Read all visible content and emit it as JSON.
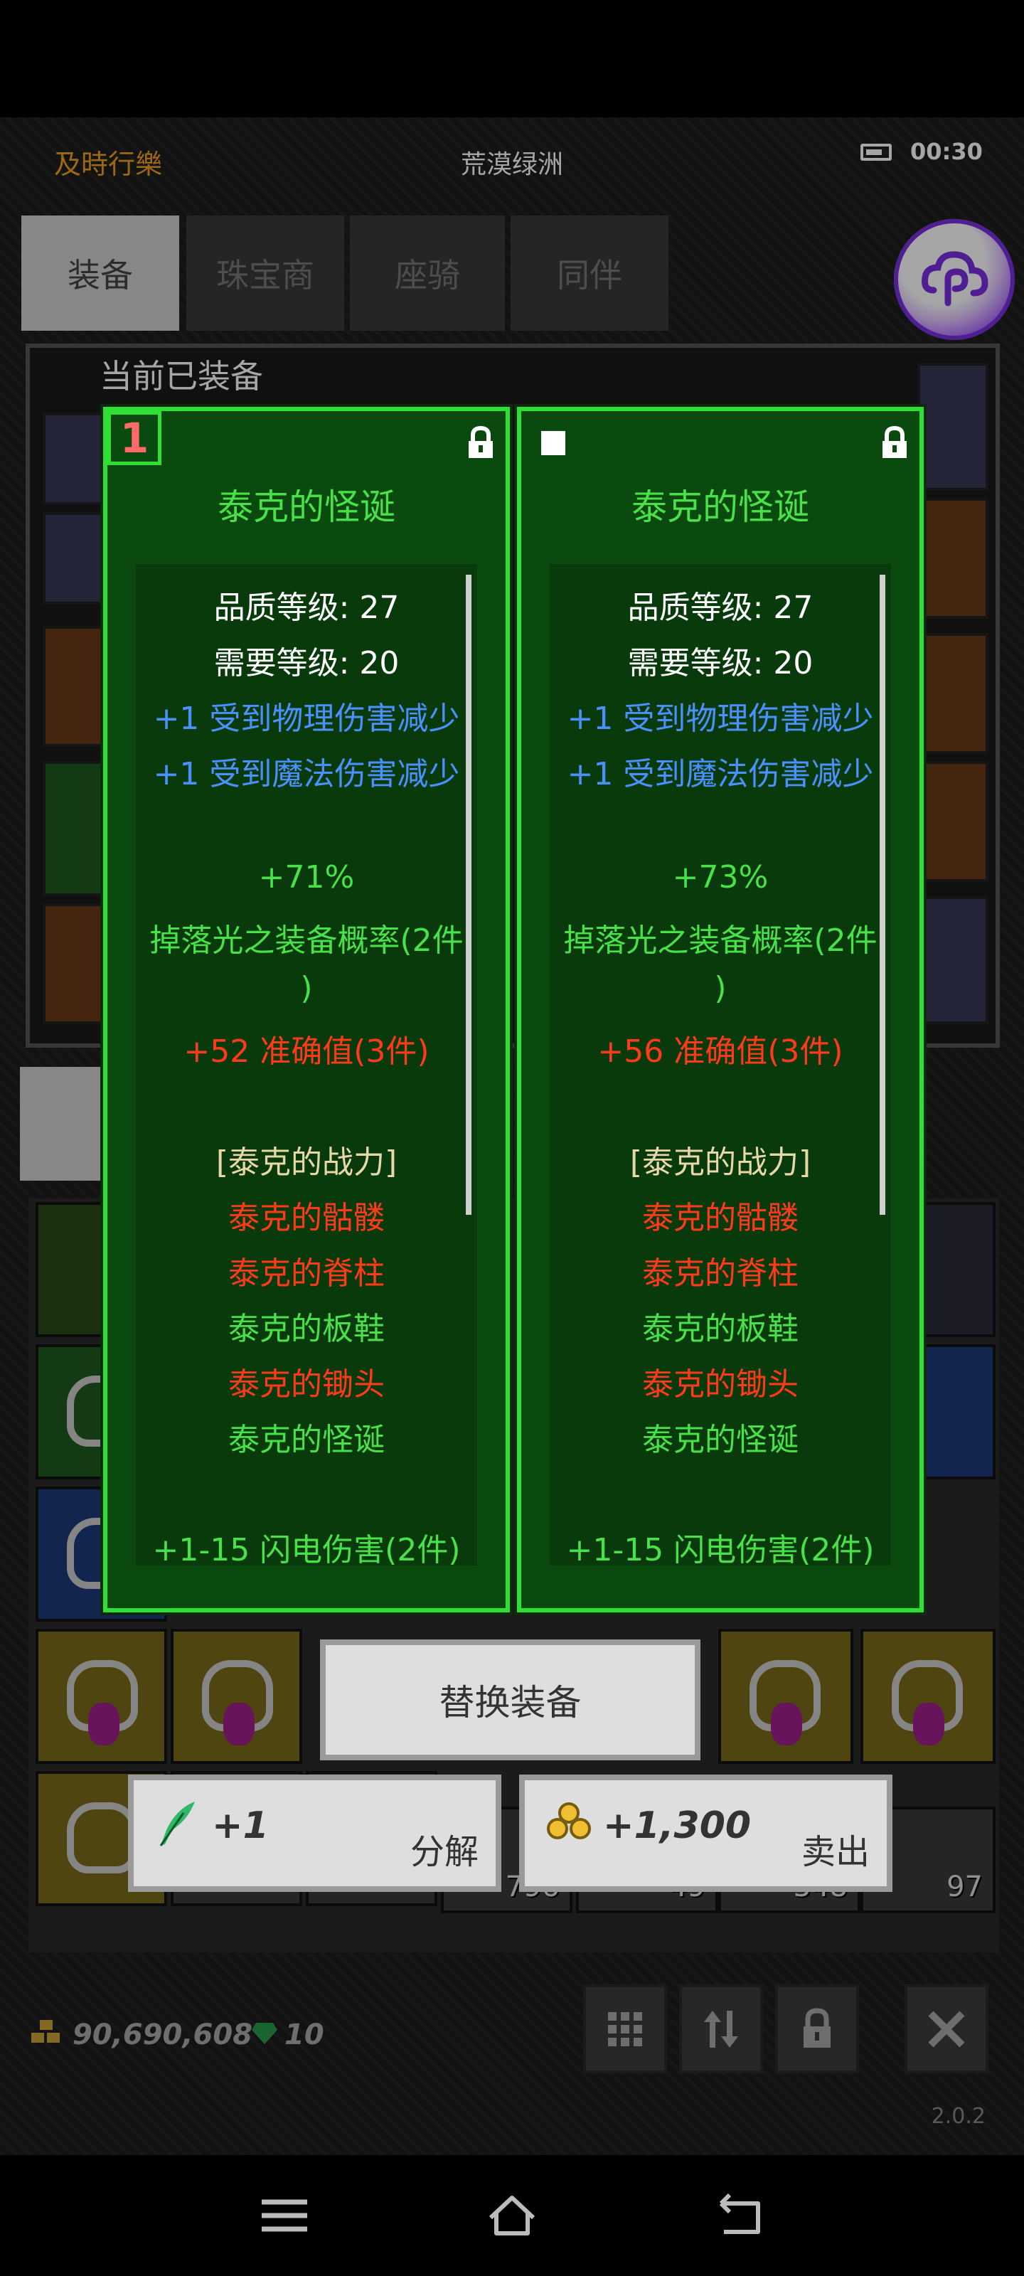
{
  "status_bar": {
    "app_name": "及時行樂",
    "location": "荒漠绿洲",
    "time": "00:30"
  },
  "top_tabs": [
    "装备",
    "珠宝商",
    "座骑",
    "同伴"
  ],
  "equipped_panel": {
    "title": "当前已装备"
  },
  "cards": [
    {
      "badge": "1",
      "name": "泰克的怪诞",
      "quality_level": "品质等级: 27",
      "required_level": "需要等级: 20",
      "mods": [
        "+1 受到物理伤害减少",
        "+1 受到魔法伤害减少"
      ],
      "bonus_pct": "+71%",
      "bonus_desc_1": "掉落光之装备概率(2件",
      "bonus_desc_2": ")",
      "accuracy": "+52 准确值(3件)",
      "set_name": "[泰克的战力]",
      "set_items": [
        "泰克的骷髅",
        "泰克的脊柱",
        "泰克的板鞋",
        "泰克的锄头",
        "泰克的怪诞"
      ],
      "lightning": "+1-15 闪电伤害(2件)"
    },
    {
      "badge": "",
      "name": "泰克的怪诞",
      "quality_level": "品质等级: 27",
      "required_level": "需要等级: 20",
      "mods": [
        "+1 受到物理伤害减少",
        "+1 受到魔法伤害减少"
      ],
      "bonus_pct": "+73%",
      "bonus_desc_1": "掉落光之装备概率(2件",
      "bonus_desc_2": ")",
      "accuracy": "+56 准确值(3件)",
      "set_name": "[泰克的战力]",
      "set_items": [
        "泰克的骷髅",
        "泰克的脊柱",
        "泰克的板鞋",
        "泰克的锄头",
        "泰克的怪诞"
      ],
      "lightning": "+1-15 闪电伤害(2件)"
    }
  ],
  "set_item_colors": [
    "#ff3a1a",
    "#ff3a1a",
    "#49e04a",
    "#ff3a1a",
    "#49e04a"
  ],
  "actions": {
    "replace": "替换装备",
    "dismantle_amount": "+1",
    "dismantle_label": "分解",
    "sell_amount": "+1,300",
    "sell_label": "卖出"
  },
  "inventory_counts": [
    "796",
    "49",
    "548",
    "97"
  ],
  "resources": {
    "gold": "90,690,608",
    "gems": "10"
  },
  "version": "2.0.2",
  "icons": [
    "battery-icon",
    "assistant-icon",
    "lock-icon",
    "feather-icon",
    "gold-coins-icon",
    "emerald-icon",
    "grid-icon",
    "sort-icon",
    "lock-icon",
    "close-icon",
    "menu-icon",
    "home-icon",
    "back-icon"
  ]
}
